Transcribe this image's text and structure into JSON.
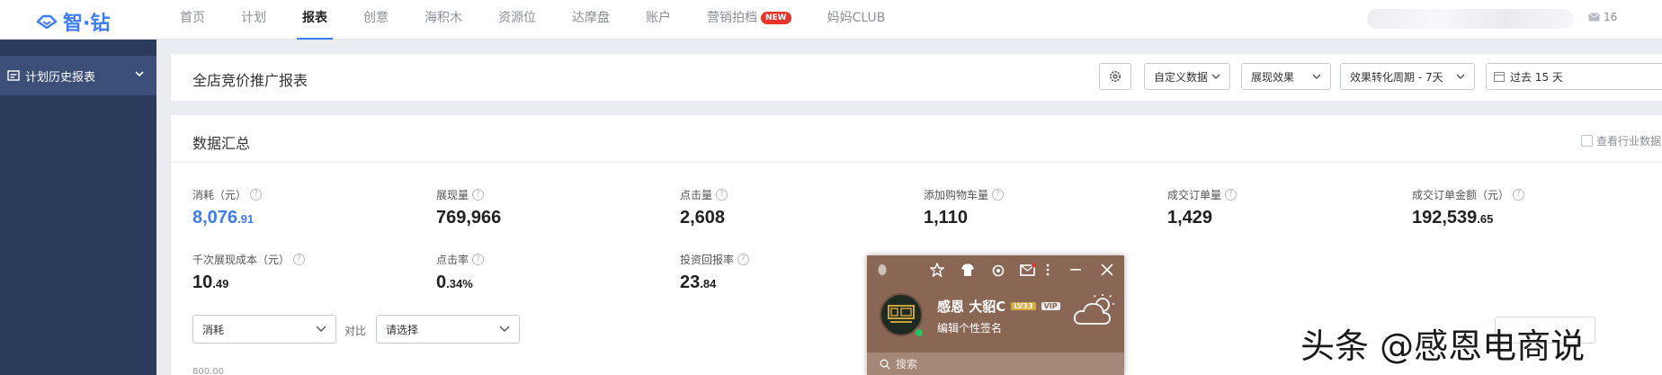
{
  "brand": {
    "name": "智·钻"
  },
  "nav": {
    "items": [
      {
        "label": "首页",
        "active": false
      },
      {
        "label": "计划",
        "active": false
      },
      {
        "label": "报表",
        "active": true
      },
      {
        "label": "创意",
        "active": false
      },
      {
        "label": "海积木",
        "active": false
      },
      {
        "label": "资源位",
        "active": false
      },
      {
        "label": "达摩盘",
        "active": false
      },
      {
        "label": "账户",
        "active": false
      },
      {
        "label": "营销拍档",
        "active": false,
        "badge": "NEW"
      },
      {
        "label": "妈妈CLUB",
        "active": false
      }
    ],
    "mail_count": "16"
  },
  "sidebar": {
    "items": [
      {
        "label": "计划历史报表",
        "icon": "report-icon"
      }
    ]
  },
  "report_header": {
    "title": "全店竞价推广报表",
    "selects": [
      {
        "value": "自定义数据"
      },
      {
        "value": "展现效果"
      },
      {
        "value": "效果转化周期 - 7天"
      }
    ],
    "date_range": "过去 15 天"
  },
  "summary": {
    "title": "数据汇总",
    "industry_checkbox": "查看行业数据",
    "metrics": [
      {
        "label": "消耗（元）",
        "int": "8,076",
        "dec": ".91",
        "highlight": true
      },
      {
        "label": "展现量",
        "int": "769,966",
        "dec": ""
      },
      {
        "label": "点击量",
        "int": "2,608",
        "dec": ""
      },
      {
        "label": "添加购物车量",
        "int": "1,110",
        "dec": ""
      },
      {
        "label": "成交订单量",
        "int": "1,429",
        "dec": ""
      },
      {
        "label": "成交订单金额（元）",
        "int": "192,539",
        "dec": ".65"
      },
      {
        "label": "千次展现成本（元）",
        "int": "10",
        "dec": ".49"
      },
      {
        "label": "点击率",
        "int": "0",
        "dec": ".34%"
      },
      {
        "label": "投资回报率",
        "int": "23",
        "dec": ".84"
      }
    ],
    "compare": {
      "left_value": "消耗",
      "label": "对比",
      "right_placeholder": "请选择"
    },
    "axis_start": "800.00"
  },
  "qq": {
    "name": "感恩 大貂C",
    "level": "LV33",
    "vip": "VIP",
    "signature": "编辑个性签名",
    "search_placeholder": "搜索"
  },
  "watermark": "头条 @感恩电商说",
  "colors": {
    "accent": "#3d7cf5",
    "sidebar": "#2b3b5c",
    "sidebar_active": "#3b4f78",
    "new_badge": "#e8352a",
    "qq_bg": "#8a6654"
  }
}
